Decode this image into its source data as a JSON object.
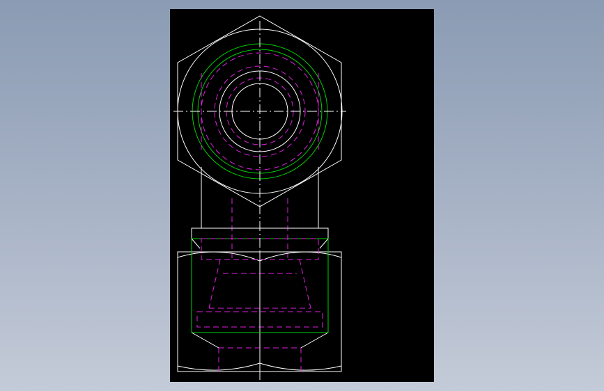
{
  "viewport": {
    "background": "#000000"
  },
  "colors": {
    "outline": "#ffffff",
    "thread": "#00d000",
    "hidden": "#e01ee0",
    "centerline": "#ffffff"
  },
  "views": {
    "top": "hex-nut-end-view",
    "front": "elbow-fitting-side-view"
  }
}
